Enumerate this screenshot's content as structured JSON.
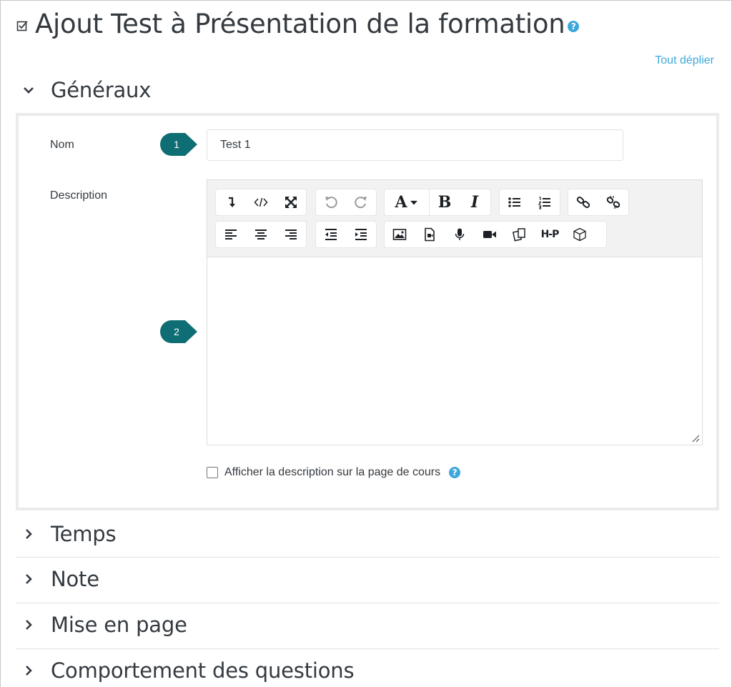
{
  "page": {
    "title": "Ajout Test à Présentation de la formation",
    "help_glyph": "?",
    "expand_all": "Tout déplier"
  },
  "sections": {
    "general": "Généraux",
    "timing": "Temps",
    "grade": "Note",
    "layout": "Mise en page",
    "behaviour": "Comportement des questions"
  },
  "form": {
    "name_label": "Nom",
    "name_value": "Test 1",
    "description_label": "Description",
    "show_description_label": "Afficher la description sur la page de cours"
  },
  "markers": {
    "first": "1",
    "second": "2"
  },
  "toolbar": {
    "font_glyph": "A",
    "bold_glyph": "B",
    "italic_glyph": "I",
    "h5p_label": "H-P"
  },
  "colors": {
    "accent": "#3fa7dc",
    "marker": "#0f6e73",
    "text": "#343a40"
  }
}
